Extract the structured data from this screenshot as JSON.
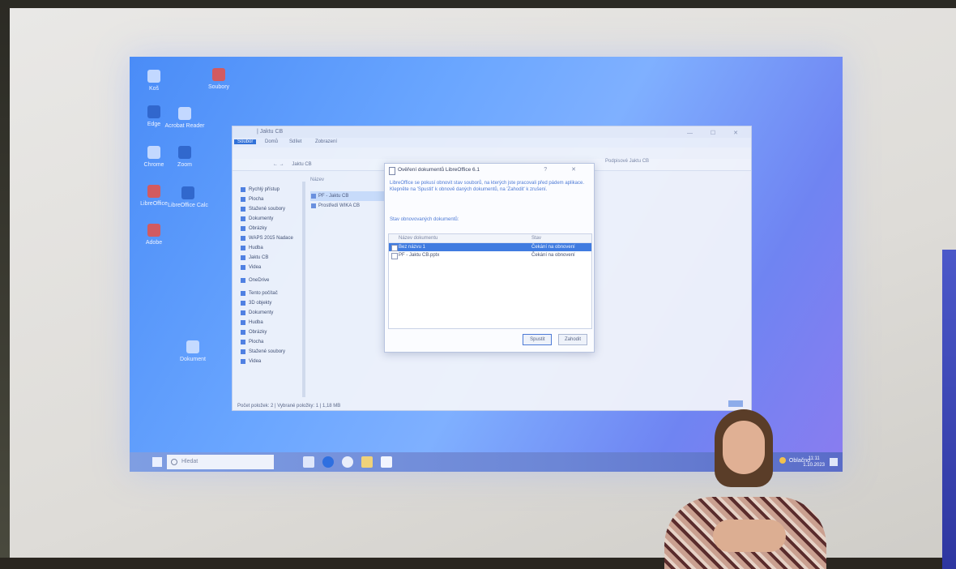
{
  "explorer": {
    "title": "| Jaktu CB",
    "ribbon_tabs": [
      "Soubor",
      "Domů",
      "Sdílet",
      "Zobrazení"
    ],
    "address": "Jaktu CB",
    "column_name": "Název",
    "nav_items": [
      "Rychlý přístup",
      "Plocha",
      "Stažené soubory",
      "Dokumenty",
      "Obrázky",
      "WAPS 2015 Nadace",
      "Hudba",
      "Jaktu CB",
      "Videa",
      "OneDrive",
      "Tento počítač",
      "3D objekty",
      "Dokumenty",
      "Hudba",
      "Obrázky",
      "Plocha",
      "Stažené soubory",
      "Videa"
    ],
    "files": [
      {
        "name": "PF - Jaktu CB",
        "selected": true
      },
      {
        "name": "Prostředí WIKA CB",
        "selected": false
      }
    ],
    "preview_label": "Podpisové Jaktu CB",
    "status": "Počet položek: 2 | Vybrané položky: 1 | 1,18 MB",
    "controls": "— ☐ ✕"
  },
  "dialog": {
    "title": "Ověření dokumentů LibreOffice 6.1",
    "close": "? ✕",
    "text": "LibreOffice se pokusí obnovit stav souborů, na kterých jste pracovali před pádem aplikace. Klepněte na 'Spustit' k obnově daných dokumentů, na 'Zahodit' k zrušení.",
    "section_label": "Stav obnovovaných dokumentů:",
    "col_name": "Název dokumentu",
    "col_status": "Stav",
    "rows": [
      {
        "name": "Bez názvu 1",
        "status": "Čekání na obnovení",
        "selected": true
      },
      {
        "name": "PF - Jaktu CB.pptx",
        "status": "Čekání na obnovení",
        "selected": false
      }
    ],
    "btn_start": "Spustit",
    "btn_discard": "Zahodit"
  },
  "taskbar": {
    "search_placeholder": "Hledat",
    "weather": "Oblačno",
    "clock_time": "11:11",
    "clock_date": "1.10.2023"
  },
  "desktop_icons": [
    {
      "label": "Koš",
      "icon": "recycle-bin-icon"
    },
    {
      "label": "Acrobat Reader",
      "icon": "pdf-icon"
    },
    {
      "label": "Soubory",
      "icon": "folder-icon"
    },
    {
      "label": "Edge",
      "icon": "browser-icon"
    },
    {
      "label": "LibreOffice",
      "icon": "libreoffice-icon"
    },
    {
      "label": "Zoom",
      "icon": "zoom-icon"
    },
    {
      "label": "Chrome",
      "icon": "chrome-icon"
    },
    {
      "label": "LibreOffice Calc",
      "icon": "calc-icon"
    },
    {
      "label": "Adobe",
      "icon": "adobe-icon"
    },
    {
      "label": "Dokument",
      "icon": "document-icon"
    }
  ]
}
